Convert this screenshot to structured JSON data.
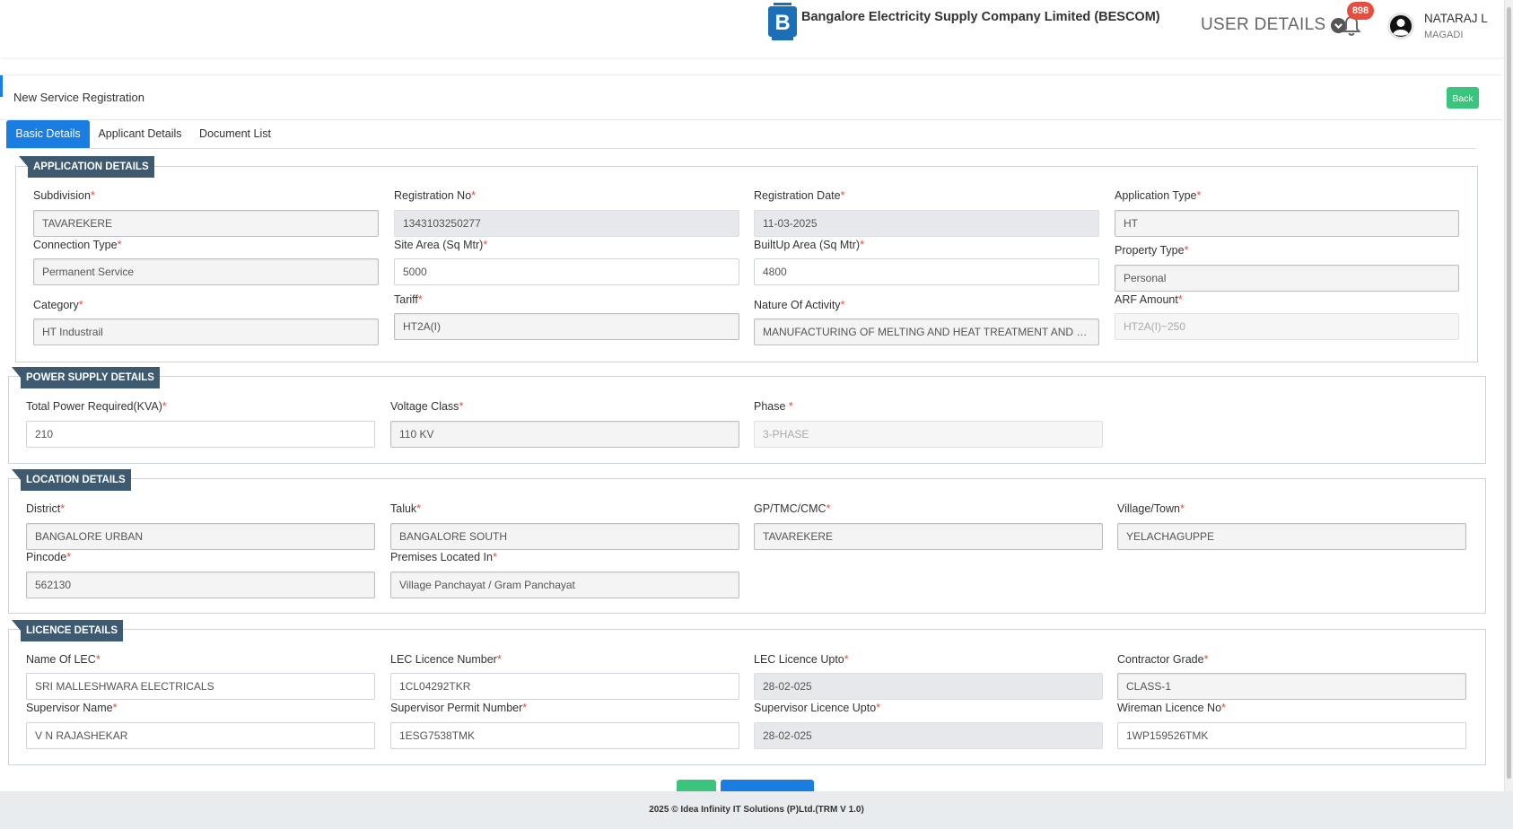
{
  "header": {
    "company": "Bangalore Electricity Supply Company Limited (BESCOM)",
    "user_details_label": "USER DETAILS",
    "notification_count": "898",
    "user_name": "NATARAJ L",
    "user_location": "MAGADI"
  },
  "page": {
    "title": "New Service Registration",
    "back_label": "Back"
  },
  "tabs": [
    {
      "label": "Basic Details",
      "active": true
    },
    {
      "label": "Applicant Details",
      "active": false
    },
    {
      "label": "Document List",
      "active": false
    }
  ],
  "sections": {
    "application": {
      "legend": "APPLICATION DETAILS",
      "subdivision": {
        "label": "Subdivision",
        "value": "TAVAREKERE"
      },
      "registration_no": {
        "label": "Registration No",
        "value": "1343103250277"
      },
      "registration_date": {
        "label": "Registration Date",
        "value": "11-03-2025"
      },
      "application_type": {
        "label": "Application Type",
        "value": "HT"
      },
      "connection_type": {
        "label": "Connection Type",
        "value": "Permanent Service"
      },
      "site_area": {
        "label": "Site Area (Sq Mtr)",
        "value": "5000"
      },
      "builtup_area": {
        "label": "BuiltUp Area (Sq Mtr)",
        "value": "4800"
      },
      "property_type": {
        "label": "Property Type",
        "value": "Personal"
      },
      "category": {
        "label": "Category",
        "value": "HT Industrail"
      },
      "tariff": {
        "label": "Tariff",
        "value": "HT2A(I)"
      },
      "nature_of_activity": {
        "label": "Nature Of Activity",
        "value": "MANUFACTURING OF MELTING AND HEAT TREATMENT AND FIN..."
      },
      "arf_amount": {
        "label": "ARF Amount",
        "value": "HT2A(I)~250"
      }
    },
    "power": {
      "legend": "POWER SUPPLY DETAILS",
      "total_power": {
        "label": "Total Power Required(KVA)",
        "value": "210"
      },
      "voltage_class": {
        "label": "Voltage Class",
        "value": "110 KV"
      },
      "phase": {
        "label": "Phase ",
        "value": "3-PHASE"
      }
    },
    "location": {
      "legend": "LOCATION DETAILS",
      "district": {
        "label": "District",
        "value": "BANGALORE URBAN"
      },
      "taluk": {
        "label": "Taluk",
        "value": "BANGALORE SOUTH"
      },
      "gp": {
        "label": "GP/TMC/CMC",
        "value": "TAVAREKERE"
      },
      "village": {
        "label": "Village/Town",
        "value": "YELACHAGUPPE"
      },
      "pincode": {
        "label": "Pincode",
        "value": "562130"
      },
      "premises": {
        "label": "Premises Located In",
        "value": "Village Panchayat / Gram Panchayat"
      }
    },
    "licence": {
      "legend": "LICENCE DETAILS",
      "lec_name": {
        "label": "Name Of LEC",
        "value": "SRI MALLESHWARA ELECTRICALS"
      },
      "lec_number": {
        "label": "LEC Licence Number",
        "value": "1CL04292TKR"
      },
      "lec_upto": {
        "label": "LEC Licence Upto",
        "value": "28-02-025"
      },
      "contractor_grade": {
        "label": "Contractor Grade",
        "value": "CLASS-1"
      },
      "supervisor_name": {
        "label": "Supervisor Name",
        "value": "V N RAJASHEKAR"
      },
      "supervisor_permit": {
        "label": "Supervisor Permit Number",
        "value": "1ESG7538TMK"
      },
      "supervisor_upto": {
        "label": "Supervisor Licence Upto",
        "value": "28-02-025"
      },
      "wireman_no": {
        "label": "Wireman Licence No",
        "value": "1WP159526TMK"
      }
    }
  },
  "footer": {
    "text": "2025 © Idea Infinity IT Solutions (P)Ltd.(TRM V 1.0)"
  },
  "colors": {
    "primary": "#1a7de2",
    "success": "#3ac47d",
    "legend": "#3e5a70",
    "required": "#e74c3c"
  }
}
